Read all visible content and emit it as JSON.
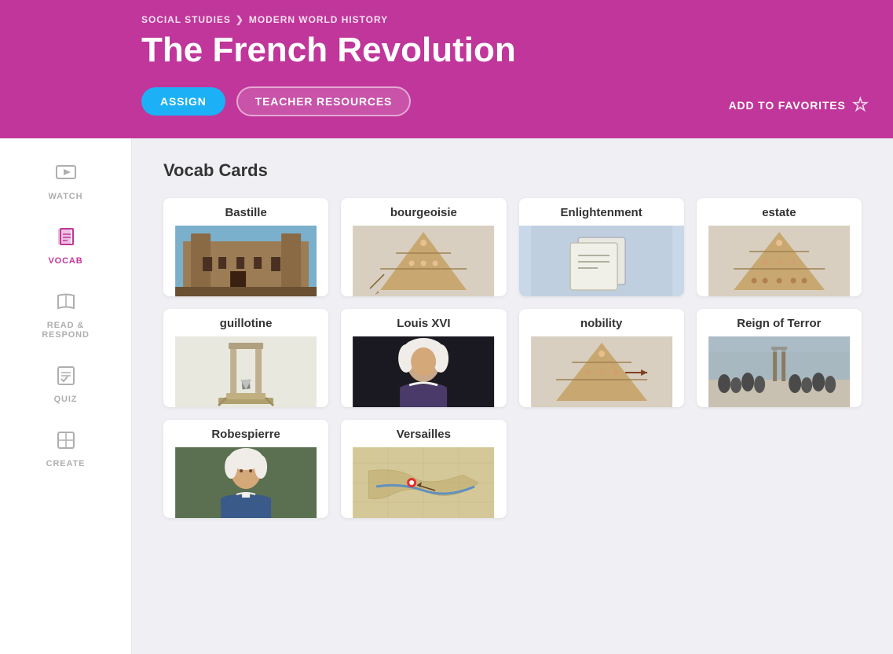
{
  "header": {
    "breadcrumb_subject": "SOCIAL STUDIES",
    "breadcrumb_separator": "❯",
    "breadcrumb_topic": "MODERN WORLD HISTORY",
    "title": "The French Revolution",
    "btn_assign": "ASSIGN",
    "btn_teacher": "TEACHER RESOURCES",
    "btn_favorites": "ADD TO FAVORITES"
  },
  "sidebar": {
    "items": [
      {
        "id": "watch",
        "label": "WATCH",
        "icon": "▶",
        "active": false
      },
      {
        "id": "vocab",
        "label": "VOCAB",
        "icon": "📖",
        "active": true
      },
      {
        "id": "read",
        "label": "READ &\nRESPOND",
        "icon": "📚",
        "active": false
      },
      {
        "id": "quiz",
        "label": "QUIZ",
        "icon": "✏",
        "active": false
      },
      {
        "id": "create",
        "label": "CREATE",
        "icon": "🎨",
        "active": false
      }
    ]
  },
  "main": {
    "section_title": "Vocab Cards",
    "cards": [
      {
        "id": "bastille",
        "title": "Bastille",
        "img_type": "bastille"
      },
      {
        "id": "bourgeoisie",
        "title": "bourgeoisie",
        "img_type": "pyramid"
      },
      {
        "id": "enlightenment",
        "title": "Enlightenment",
        "img_type": "enlightenment"
      },
      {
        "id": "estate",
        "title": "estate",
        "img_type": "pyramid2"
      },
      {
        "id": "guillotine",
        "title": "guillotine",
        "img_type": "guillotine"
      },
      {
        "id": "louis-xvi",
        "title": "Louis XVI",
        "img_type": "louis"
      },
      {
        "id": "nobility",
        "title": "nobility",
        "img_type": "pyramid3"
      },
      {
        "id": "reign-of-terror",
        "title": "Reign of Terror",
        "img_type": "reign"
      },
      {
        "id": "robespierre",
        "title": "Robespierre",
        "img_type": "robespierre"
      },
      {
        "id": "versailles",
        "title": "Versailles",
        "img_type": "versailles"
      }
    ]
  },
  "colors": {
    "header_bg": "#c0369a",
    "assign_btn": "#1cb0f6",
    "active_nav": "#c0369a",
    "inactive_nav": "#afafaf"
  }
}
